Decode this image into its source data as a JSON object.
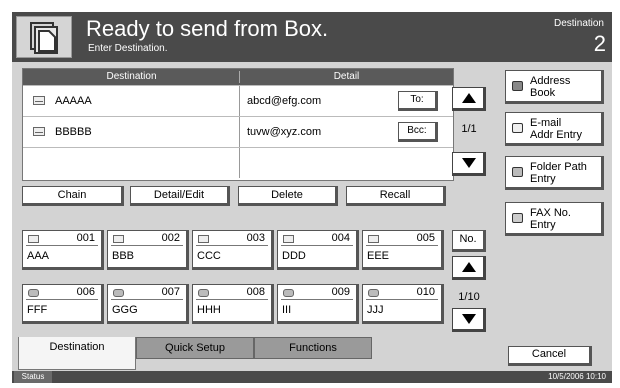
{
  "header": {
    "title": "Ready to send from Box.",
    "subtitle": "Enter Destination.",
    "destination_label": "Destination",
    "destination_count": "2"
  },
  "destination_table": {
    "col_destination": "Destination",
    "col_detail": "Detail",
    "rows": [
      {
        "name": "AAAAA",
        "address": "abcd@efg.com",
        "kind": "To:"
      },
      {
        "name": "BBBBB",
        "address": "tuvw@xyz.com",
        "kind": "Bcc:"
      }
    ],
    "page": "1/1"
  },
  "actions": {
    "chain": "Chain",
    "detail_edit": "Detail/Edit",
    "delete": "Delete",
    "recall": "Recall"
  },
  "side_buttons": [
    {
      "label1": "Address",
      "label2": "Book"
    },
    {
      "label1": "E-mail",
      "label2": "Addr Entry"
    },
    {
      "label1": "Folder Path",
      "label2": "Entry"
    },
    {
      "label1": "FAX No.",
      "label2": "Entry"
    }
  ],
  "one_touch": {
    "keys": [
      {
        "num": "001",
        "name": "AAA"
      },
      {
        "num": "002",
        "name": "BBB"
      },
      {
        "num": "003",
        "name": "CCC"
      },
      {
        "num": "004",
        "name": "DDD"
      },
      {
        "num": "005",
        "name": "EEE"
      },
      {
        "num": "006",
        "name": "FFF"
      },
      {
        "num": "007",
        "name": "GGG"
      },
      {
        "num": "008",
        "name": "HHH"
      },
      {
        "num": "009",
        "name": "III"
      },
      {
        "num": "010",
        "name": "JJJ"
      }
    ],
    "no_label": "No.",
    "page": "1/10"
  },
  "tabs": {
    "destination": "Destination",
    "quick_setup": "Quick Setup",
    "functions": "Functions"
  },
  "cancel": "Cancel",
  "status": {
    "label": "Status",
    "datetime": "10/5/2006   10:10"
  }
}
